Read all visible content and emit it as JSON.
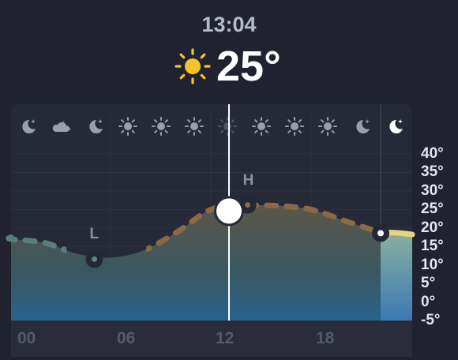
{
  "header": {
    "time": "13:04",
    "current_icon": "sun-icon",
    "current_temp": "25°"
  },
  "colors": {
    "background": "#20222f",
    "panel": "#262a37",
    "sun": "#f5c42c",
    "warm_line": "#8a6a44",
    "cool_line": "#5a7f7a",
    "current_line": "#e6d47a",
    "fill_top": "#6e6650",
    "fill_bottom": "#2e6a94"
  },
  "hourly_icons": [
    "moon-icon",
    "cloud-moon-icon",
    "moon-icon",
    "sun-icon",
    "sun-icon",
    "sun-icon",
    "sun-icon",
    "sun-icon",
    "sun-icon",
    "sun-icon",
    "moon-icon",
    "moon-icon"
  ],
  "chart_data": {
    "type": "line",
    "x": [
      "00",
      "02",
      "04",
      "06",
      "08",
      "10",
      "12",
      "14",
      "16",
      "18",
      "20",
      "22"
    ],
    "values": [
      17,
      16,
      13,
      12,
      14,
      19,
      25,
      26,
      26,
      25,
      22,
      19
    ],
    "current": {
      "x": "13",
      "value": 25
    },
    "low": {
      "label": "L",
      "x": "05",
      "value": 12
    },
    "high": {
      "label": "H",
      "x": "14",
      "value": 26
    },
    "y_ticks": [
      "40°",
      "35°",
      "30°",
      "25°",
      "20°",
      "15°",
      "10°",
      "5°",
      "0°",
      "-5°"
    ],
    "x_ticks": [
      "00",
      "06",
      "12",
      "18"
    ],
    "ylim": [
      -5,
      40
    ]
  }
}
